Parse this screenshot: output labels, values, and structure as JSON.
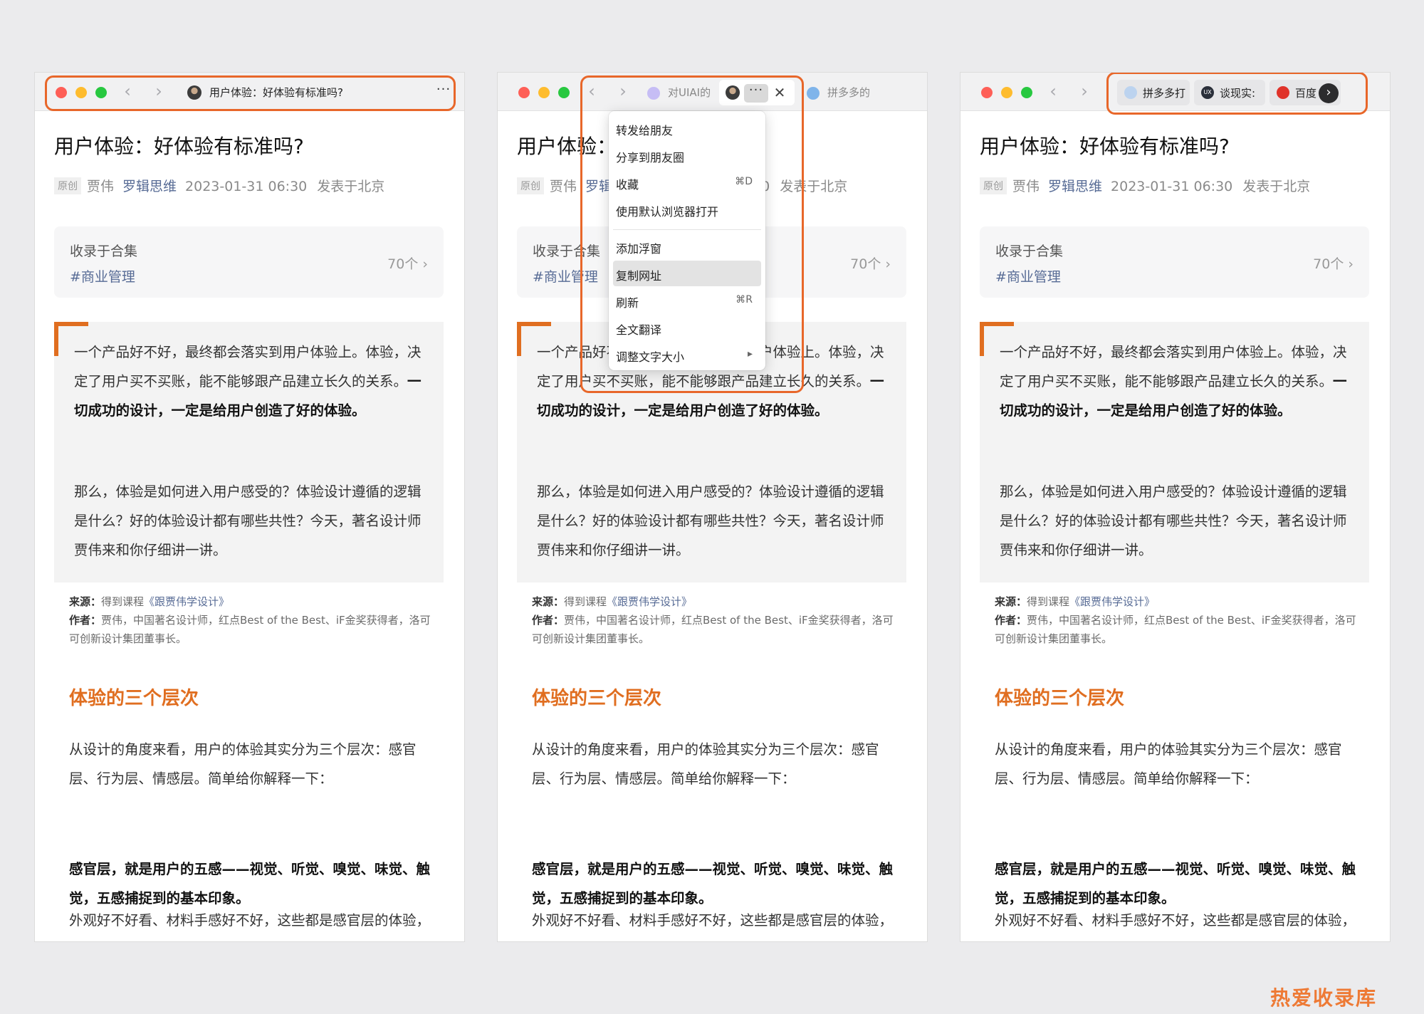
{
  "colors": {
    "accent": "#e8672a",
    "section": "#e06e20",
    "link": "#576b95"
  },
  "article": {
    "title": "用户体验：好体验有标准吗?",
    "original_badge": "原创",
    "author": "贾伟",
    "account": "罗辑思维",
    "date": "2023-01-31 06:30",
    "location": "发表于北京",
    "collection_label": "收录于合集",
    "collection_tag": "#商业管理",
    "collection_count": "70个 ›",
    "quote_p1_a": "一个产品好不好，最终都会落实到用户体验上。体验，决定了用户买不买账，能不能够跟产品建立长久的关系。",
    "quote_p1_b": "一切成功的设计，一定是给用户创造了好的体验。",
    "quote_p2": "那么，体验是如何进入用户感受的？体验设计遵循的逻辑是什么？好的体验设计都有哪些共性？今天，著名设计师贾伟来和你仔细讲一讲。",
    "source_label": "来源：",
    "source_value": "得到课程",
    "source_book": "《跟贾伟学设计》",
    "author_label": "作者：",
    "author_bio": "贾伟，中国著名设计师，红点Best of the Best、iF金奖获得者，洛可可创新设计集团董事长。",
    "section_title": "体验的三个层次",
    "body_p1": "从设计的角度来看，用户的体验其实分为三个层次：感官层、行为层、情感层。简单给你解释一下：",
    "body_p2": "感官层，就是用户的五感——视觉、听觉、嗅觉、味觉、触觉，五感捕捉到的基本印象。",
    "body_p3": "外观好不好看、材料手感好不好，这些都是感官层的体验，这个很好理解，就不多解释了。"
  },
  "panel1": {
    "tab_title": "用户体验：好体验有标准吗?",
    "more_icon": "···",
    "back_icon": "‹",
    "forward_icon": "›"
  },
  "panel2": {
    "tab1_label": "对UIAI的",
    "active_more": "···",
    "close_icon": "✕",
    "tab3_label": "拼多多的",
    "menu": {
      "items": [
        {
          "label": "转发给朋友",
          "shortcut": ""
        },
        {
          "label": "分享到朋友圈",
          "shortcut": ""
        },
        {
          "label": "收藏",
          "shortcut": "⌘D"
        },
        {
          "label": "使用默认浏览器打开",
          "shortcut": ""
        },
        {
          "label": "添加浮窗",
          "shortcut": ""
        },
        {
          "label": "复制网址",
          "shortcut": ""
        },
        {
          "label": "刷新",
          "shortcut": "⌘R"
        },
        {
          "label": "全文翻译",
          "shortcut": ""
        },
        {
          "label": "调整文字大小",
          "shortcut": "▸"
        }
      ]
    }
  },
  "panel3": {
    "pill1_label": "拼多多打",
    "pill2_label": "谈现实:",
    "pill2_icon_text": "UX",
    "pill3_label": "百度",
    "scroll_icon": "›"
  },
  "watermark": "热爱收录库"
}
